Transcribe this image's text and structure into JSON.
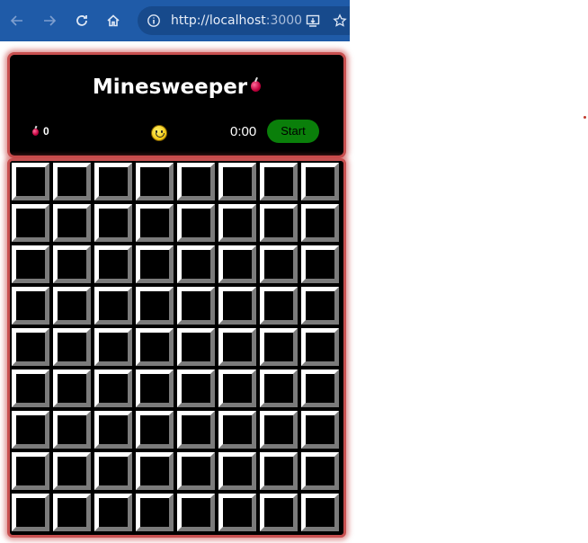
{
  "browser": {
    "url": "http://localhost",
    "port": ":3000"
  },
  "game": {
    "title": "Minesweeper",
    "mine_count": "0",
    "timer": "0:00",
    "start_label": "Start",
    "face": "smiley-icon",
    "board": {
      "rows": 9,
      "cols": 8,
      "cell_state": "unrevealed"
    }
  },
  "colors": {
    "browser_bar": "#1f5ba8",
    "panel_border": "#c85050",
    "start_button": "#0a7f0a",
    "bomb": "#c2003d"
  }
}
